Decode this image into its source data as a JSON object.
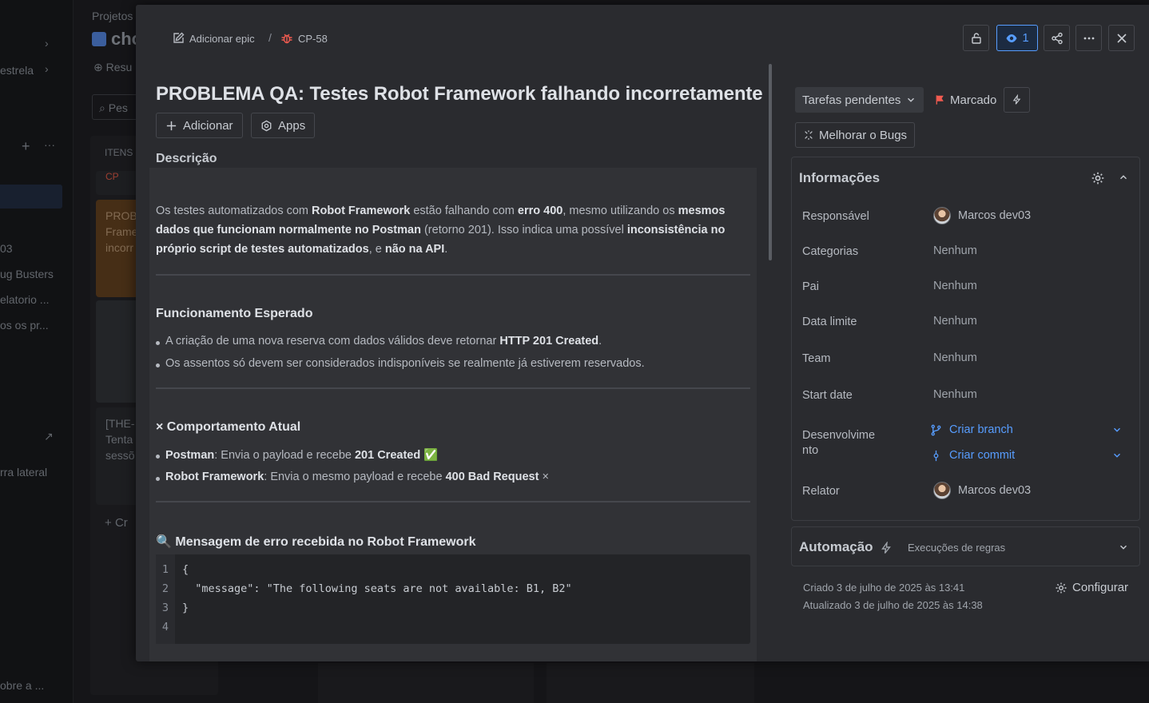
{
  "background": {
    "sidebar": {
      "items": [
        "estrela",
        "03",
        "ug Busters",
        "elatorio ...",
        "os os pr...",
        "rra lateral",
        "obre a ..."
      ]
    },
    "header": {
      "projects": "Projetos",
      "project_name": "cho",
      "summary_tab": "Resu",
      "search_placeholder": "Pes"
    },
    "board": {
      "column_title": "ITENS",
      "card_key": "CP",
      "card_text": [
        "PROB",
        "Frame",
        "incorr"
      ],
      "card2_text": [
        "[THE-",
        "Tenta",
        "sessõ"
      ],
      "create": "Cr"
    }
  },
  "modal": {
    "breadcrumb": {
      "add_epic": "Adicionar epic",
      "separator": "/",
      "issue_key": "CP-58"
    },
    "toolbar": {
      "watch_count": "1"
    },
    "title": "PROBLEMA QA: Testes Robot Framework falhando incorretamente",
    "actions": {
      "add": "Adicionar",
      "apps": "Apps"
    },
    "description_heading": "Descrição",
    "description": {
      "intro": {
        "t1": "Os testes automatizados com ",
        "b1": "Robot Framework",
        "t2": " estão falhando com ",
        "b2": "erro 400",
        "t3": ", mesmo utilizando os ",
        "b3": "mesmos dados que funcionam normalmente no Postman",
        "t4": " (retorno 201). Isso indica uma possível ",
        "b4": "inconsistência no próprio script de testes automatizados",
        "t5": ", e ",
        "b5": "não na API",
        "t6": "."
      },
      "expected": {
        "heading": "Funcionamento Esperado",
        "items": [
          {
            "t1": "A criação de uma nova reserva com dados válidos deve retornar ",
            "b1": "HTTP 201 Created",
            "t2": "."
          },
          {
            "t1": "Os assentos só devem ser considerados indisponíveis se realmente já estiverem reservados."
          }
        ]
      },
      "current": {
        "heading": "× Comportamento Atual",
        "items": [
          {
            "b1": "Postman",
            "t1": ": Envia o payload e recebe ",
            "b2": "201 Created",
            "t2": " ✅"
          },
          {
            "b1": "Robot Framework",
            "t1": ": Envia o mesmo payload e recebe ",
            "b2": "400 Bad Request",
            "t2": " ×"
          }
        ]
      },
      "error": {
        "heading": "🔍 Mensagem de erro recebida no Robot Framework",
        "code_lines": [
          "{",
          "  \"message\": \"The following seats are not available: B1, B2\"",
          "}",
          ""
        ],
        "line_numbers": [
          "1",
          "2",
          "3",
          "4"
        ]
      }
    },
    "side": {
      "status": "Tarefas pendentes",
      "flag": "Marcado",
      "improve": "Melhorar o Bugs",
      "info": {
        "heading": "Informações",
        "fields": [
          {
            "label": "Responsável",
            "value": "Marcos dev03"
          },
          {
            "label": "Categorias",
            "value": "Nenhum"
          },
          {
            "label": "Pai",
            "value": "Nenhum"
          },
          {
            "label": "Data limite",
            "value": "Nenhum"
          },
          {
            "label": "Team",
            "value": "Nenhum"
          },
          {
            "label": "Start date",
            "value": "Nenhum"
          },
          {
            "label_1": "Desenvolvime",
            "label_2": "nto",
            "branch": "Criar branch",
            "commit": "Criar commit"
          },
          {
            "label": "Relator",
            "value": "Marcos dev03"
          }
        ]
      },
      "automation": {
        "heading": "Automação",
        "runs": "Execuções de regras"
      },
      "meta": {
        "created": "Criado 3 de julho de 2025 às 13:41",
        "updated": "Atualizado 3 de julho de 2025 às 14:38",
        "configure": "Configurar"
      }
    }
  },
  "colors": {
    "accent": "#579dff",
    "flag": "#f15b50",
    "bug": "#f15b50"
  }
}
